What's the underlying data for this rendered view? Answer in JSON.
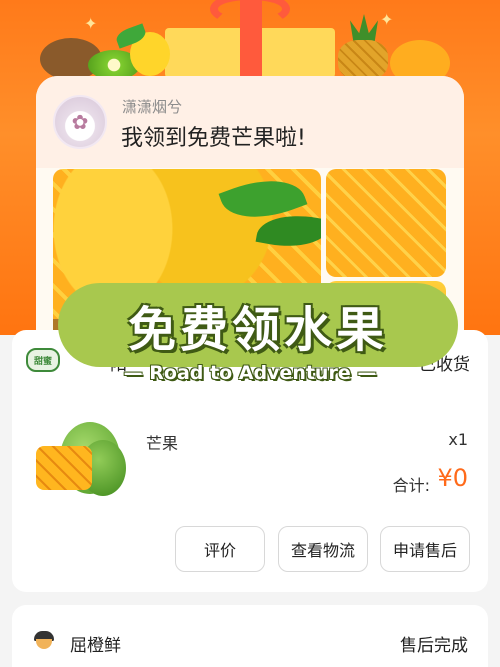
{
  "header_card": {
    "username": "潇潇烟兮",
    "message": "我领到免费芒果啦!"
  },
  "overlay": {
    "title": "免费领水果",
    "subtitle": "— Road to Adventure —"
  },
  "order_1": {
    "store_logo_text": "甜蜜",
    "store_name_fragment": "阳",
    "status": "已收货",
    "product_name": "芒果",
    "quantity": "x1",
    "total_label": "合计:",
    "total_value": "¥0",
    "buttons": {
      "review": "评价",
      "logistics": "查看物流",
      "after_sale": "申请售后"
    }
  },
  "order_2": {
    "store_name": "屈橙鲜",
    "status": "售后完成"
  },
  "colors": {
    "banner": "#ff7a1a",
    "accent_price": "#ff6a1a",
    "overlay_green": "#a8c84e"
  }
}
